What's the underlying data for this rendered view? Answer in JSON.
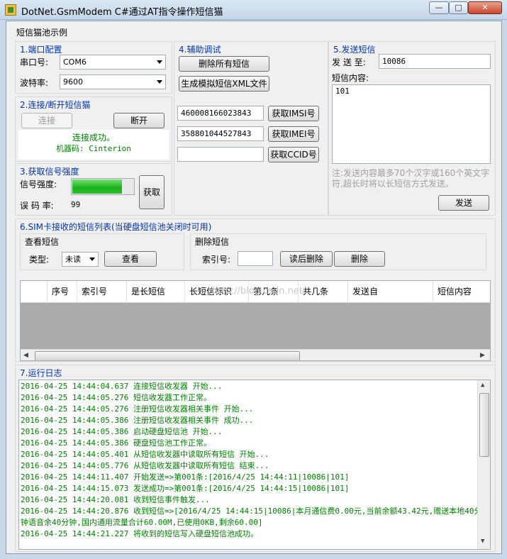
{
  "window": {
    "title": "DotNet.GsmModem C#通过AT指令操作短信猫",
    "min": "—",
    "max": "□",
    "close": "✕"
  },
  "menu": {
    "label": "短信猫池示例"
  },
  "port": {
    "title": "1.端口配置",
    "port_label": "串口号:",
    "port_value": "COM6",
    "baud_label": "波特率:",
    "baud_value": "9600"
  },
  "connect": {
    "title": "2.连接/断开短信猫",
    "connect_btn": "连接",
    "disconnect_btn": "断开",
    "status": "连接成功。",
    "machine": "机器码: Cinterion"
  },
  "signal": {
    "title": "3.获取信号强度",
    "strength_label": "信号强度:",
    "strength_fraction": 0.8,
    "error_label": "误 码 率:",
    "error_value": "99",
    "get_btn": "获取"
  },
  "debug": {
    "title": "4.辅助调试",
    "delete_all_btn": "删除所有短信",
    "gen_xml_btn": "生成模拟短信XML文件",
    "imsi_value": "460008166023843",
    "imsi_btn": "获取IMSI号",
    "imei_value": "358801044527843",
    "imei_btn": "获取IMEI号",
    "ccid_value": "",
    "ccid_btn": "获取CCID号"
  },
  "send": {
    "title": "5.发送短信",
    "to_label": "发 送 至:",
    "to_value": "10086",
    "content_label": "短信内容:",
    "content_value": "101",
    "note": "注:发送内容最多70个汉字或160个英文字符,超长时将以长短信方式发送。",
    "send_btn": "发送"
  },
  "inbox": {
    "title": "6.SIM卡接收的短信列表(当硬盘短信池关闭时可用)",
    "view_group": "查看短信",
    "type_label": "类型:",
    "type_value": "未读",
    "view_btn": "查看",
    "delete_group": "删除短信",
    "index_label": "索引号:",
    "index_value": "",
    "read_delete_btn": "读后删除",
    "delete_btn": "删除",
    "columns": [
      "序号",
      "索引号",
      "是长短信",
      "长短信标识",
      "第几条",
      "共几条",
      "发送自",
      "短信内容"
    ],
    "watermark": "http://blog.csdn.net/"
  },
  "log": {
    "title": "7.运行日志",
    "lines": [
      "2016-04-25 14:44:04.637 连接短信收发器 开始...",
      "2016-04-25 14:44:05.276 短信收发器工作正常。",
      "2016-04-25 14:44:05.276 注册短信收发器相关事件 开始...",
      "2016-04-25 14:44:05.386 注册短信收发器相关事件 成功...",
      "2016-04-25 14:44:05.386 启动硬盘短信池 开始...",
      "2016-04-25 14:44:05.386 硬盘短信池工作正常。",
      "2016-04-25 14:44:05.401 从短信收发器中读取所有短信 开始...",
      "2016-04-25 14:44:05.776 从短信收发器中读取所有短信 结束...",
      "2016-04-25 14:44:11.407 开始发送=>第001条:[2016/4/25 14:44:11|10086|101]",
      "2016-04-25 14:44:15.073 发送成功=>第001条:[2016/4/25 14:44:15|10086|101]",
      "2016-04-25 14:44:20.081 收到短信事件触发...",
      "2016-04-25 14:44:20.876 收到短信=>[2016/4/25 14:44:15|10086|本月通信费0.00元,当前余额43.42元,赠送本地40分",
      "钟语音余40分钟,国内通用流量合计60.00M,已使用0KB,剩余60.00]",
      "2016-04-25 14:44:21.227 将收到的短信写入硬盘短信池成功。"
    ]
  }
}
